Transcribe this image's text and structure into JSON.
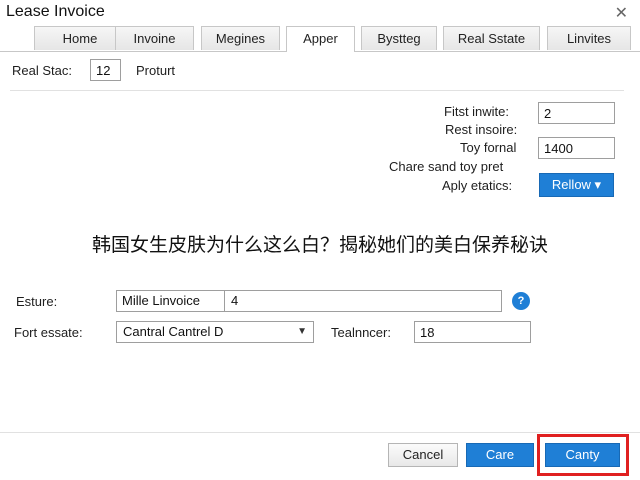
{
  "window": {
    "title": "Lease Invoice"
  },
  "tabs": [
    {
      "label": "Home"
    },
    {
      "label": "Invoine"
    },
    {
      "label": "Megines"
    },
    {
      "label": "Apper"
    },
    {
      "label": "Bystteg"
    },
    {
      "label": "Real Sstate"
    },
    {
      "label": "Linvites"
    }
  ],
  "active_tab": "Apper",
  "top_row": {
    "label": "Real Stac:",
    "value": "12",
    "suffix": "Proturt"
  },
  "right_fields": {
    "first_invite_label": "Fitst inwite:",
    "first_invite_value": "2",
    "rest_label": "Rest insoire:",
    "total_label": "Toy fornal",
    "total_value": "1400",
    "charge_label": "Chare sand toy pret",
    "apply_label": "Aply etatics:",
    "apply_button": "Rellow ▾"
  },
  "banner_text": "韩国女生皮肤为什么这么白？揭秘她们的美白保养秘诀",
  "form": {
    "esture_label": "Esture:",
    "esture_name": "Mille Linvoice",
    "esture_value": "4",
    "fort_label": "Fort essate:",
    "fort_select": "Cantral Cantrel D",
    "teal_label": "Tealnncer:",
    "teal_value": "18"
  },
  "footer": {
    "cancel": "Cancel",
    "care": "Care",
    "canty": "Canty"
  },
  "colors": {
    "accent": "#1f7fd6",
    "highlight": "#e02020"
  },
  "icons": {
    "close": "close-icon",
    "help": "help-icon",
    "caret": "chevron-down-icon"
  }
}
